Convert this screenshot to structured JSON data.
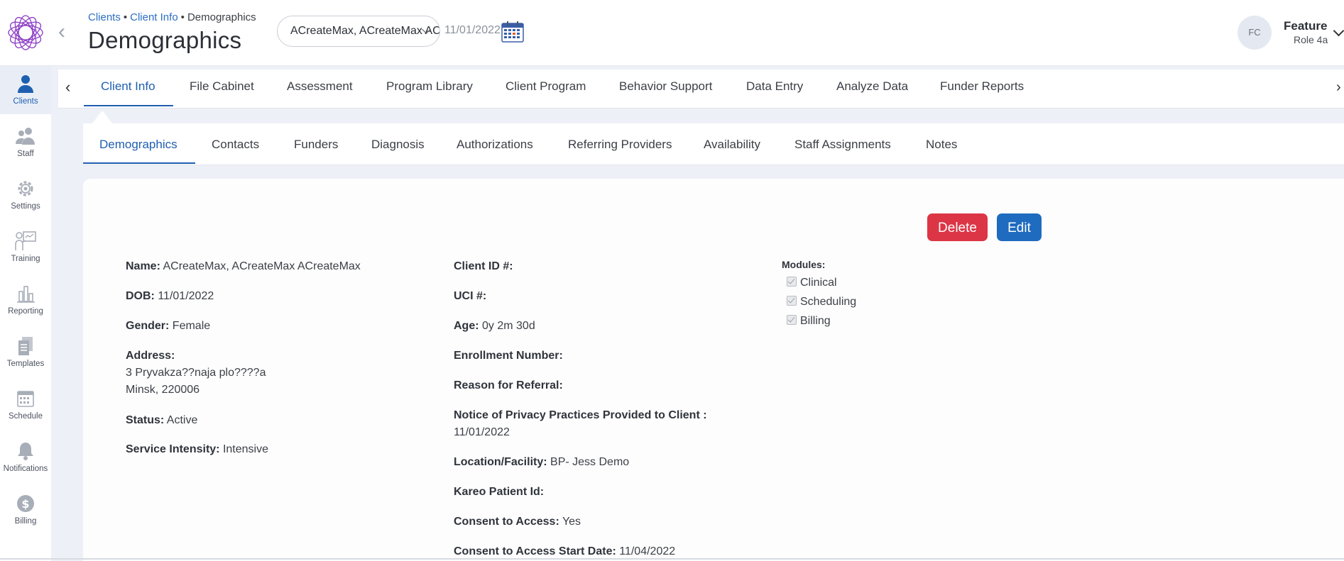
{
  "header": {
    "breadcrumb": [
      "Clients",
      "Client Info",
      "Demographics"
    ],
    "breadcrumb_sep": "•",
    "title": "Demographics",
    "client_select_value": "ACreateMax, ACreateMax ACreateMax",
    "date": "11/01/2022",
    "user_initials": "FC",
    "user_name": "Feature",
    "user_role": "Role 4a"
  },
  "sidebar": {
    "items": [
      {
        "label": "Clients",
        "icon": "person-icon",
        "active": true
      },
      {
        "label": "Staff",
        "icon": "people-icon"
      },
      {
        "label": "Settings",
        "icon": "gear-icon"
      },
      {
        "label": "Training",
        "icon": "training-icon"
      },
      {
        "label": "Reporting",
        "icon": "bar-chart-icon"
      },
      {
        "label": "Templates",
        "icon": "documents-icon"
      },
      {
        "label": "Schedule",
        "icon": "calendar-icon"
      },
      {
        "label": "Notifications",
        "icon": "bell-icon"
      },
      {
        "label": "Billing",
        "icon": "dollar-icon"
      }
    ],
    "accent": "#1f5fb0"
  },
  "tabs": [
    "Client Info",
    "File Cabinet",
    "Assessment",
    "Program Library",
    "Client Program",
    "Behavior Support",
    "Data Entry",
    "Analyze Data",
    "Funder Reports"
  ],
  "subtabs": [
    "Demographics",
    "Contacts",
    "Funders",
    "Diagnosis",
    "Authorizations",
    "Referring Providers",
    "Availability",
    "Staff Assignments",
    "Notes"
  ],
  "actions": {
    "delete": "Delete",
    "edit": "Edit",
    "delete_color": "#dc3545",
    "edit_color": "#1f6bbf"
  },
  "left_fields": {
    "name": {
      "label": "Name:",
      "value": "ACreateMax, ACreateMax ACreateMax"
    },
    "dob": {
      "label": "DOB:",
      "value": "11/01/2022"
    },
    "gender": {
      "label": "Gender:",
      "value": "Female"
    },
    "address": {
      "label": "Address:",
      "line1": "3 Pryvakza??naja plo????a",
      "line2": "Minsk, 220006"
    },
    "status": {
      "label": "Status:",
      "value": "Active"
    },
    "service_intensity": {
      "label": "Service Intensity:",
      "value": "Intensive"
    }
  },
  "mid_fields": {
    "client_id": {
      "label": "Client ID #:",
      "value": ""
    },
    "uci": {
      "label": "UCI #:",
      "value": ""
    },
    "age": {
      "label": "Age:",
      "value": "0y 2m 30d"
    },
    "enrollment": {
      "label": "Enrollment Number:",
      "value": ""
    },
    "referral_reason": {
      "label": "Reason for Referral:",
      "value": ""
    },
    "privacy_notice": {
      "label": "Notice of Privacy Practices Provided to Client :",
      "value": "11/01/2022"
    },
    "location": {
      "label": "Location/Facility:",
      "value": "BP- Jess Demo"
    },
    "kareo": {
      "label": "Kareo Patient Id:",
      "value": ""
    },
    "consent": {
      "label": "Consent to Access:",
      "value": "Yes"
    },
    "consent_start": {
      "label": "Consent to Access Start Date:",
      "value": "11/04/2022"
    }
  },
  "modules": {
    "title": "Modules:",
    "items": [
      {
        "label": "Clinical",
        "checked": true
      },
      {
        "label": "Scheduling",
        "checked": true
      },
      {
        "label": "Billing",
        "checked": true
      }
    ]
  }
}
